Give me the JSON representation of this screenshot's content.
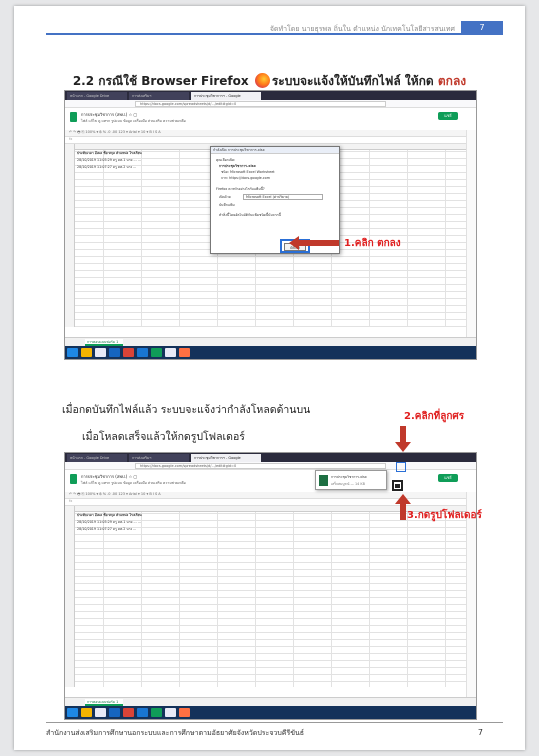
{
  "header": {
    "author_line": "จัดทำโดย นายธุรพล ถิ่นใน ตำแหน่ง นักเทคโนโลยีสารสนเทศ",
    "page_number": "7"
  },
  "section_title": {
    "prefix": "2.2 กรณีใช้ Browser Firefox",
    "suffix": "ระบบจะแจ้งให้บันทึกไฟล์ ให้กด",
    "emphasis": "ตกลง"
  },
  "screenshot1": {
    "tabs": [
      "หน้าแรก - Google Drive",
      "การส่งเสริมฯ",
      "การประชุมวิชาการฯ - Google"
    ],
    "url": "https://docs.google.com/spreadsheets/d/.../edit#gid=0",
    "doc_title": "การประชุมวิชาการ (สพป.) ☆ ▢",
    "doc_menu": "ไฟล์ แก้ไข ดู แทรก รูปแบบ ข้อมูล เครื่องมือ ส่วนเสริม ความช่วยเหลือ",
    "share_label": "แชร์",
    "toolbar": "↶ ↷ 🖶 ⎘ 100% ▾ ฿ % .0 .00 123 ▾ Arial ▾ 10 ▾ B I S A",
    "fx": "fx",
    "rows": [
      "ประทับเวลา        อีเมล           ชื่อ-สกุล         ตำแหน่ง         โรงเรียน",
      "28/10/2019 11:05:29      ครู  คศ.1  นาย ...        ...",
      "28/10/2019 11:07:27      ครู  คศ.2  นาง ..."
    ],
    "sheet_tab": "การตอบแบบฟอร์ม 1",
    "dialog": {
      "title": "กำลังเปิด การประชุมวิชาการ.xlsx",
      "line1": "คุณเลือกเปิด:",
      "file": "การประชุมวิชาการ.xlsx",
      "type": "ชนิด: Microsoft Excel Worksheet",
      "from": "จาก: https://docs.google.com",
      "question": "Firefox ควรทำอย่างไรกับแฟ้มนี้?",
      "open_with": "เปิดด้วย",
      "open_with_value": "Microsoft Excel (ค่าปริยาย)",
      "save_file": "บันทึกแฟ้ม",
      "remember": "ทำสิ่งนี้โดยอัตโนมัติกับแฟ้มชนิดนี้นับจากนี้",
      "ok": "ตกลง"
    },
    "callout": "1.คลิก ตกลง"
  },
  "paragraph": {
    "line1": "เมื่อกดบันทึกไฟล์แล้ว ระบบจะแจ้งว่ากำลังโหลดด้านบน",
    "line2": "เมื่อโหลดเสร็จแล้วให้กดรูปโฟลเดอร์"
  },
  "screenshot2": {
    "tabs": [
      "หน้าแรก - Google Drive",
      "การส่งเสริมฯ",
      "การประชุมวิชาการฯ - Google"
    ],
    "url": "https://docs.google.com/spreadsheets/d/.../edit#gid=0",
    "doc_title": "การประชุมวิชาการ (สพป.) ☆ ▢",
    "doc_menu": "ไฟล์ แก้ไข ดู แทรก รูปแบบ ข้อมูล เครื่องมือ ส่วนเสริม ความช่วยเหลือ",
    "share_label": "แชร์",
    "toolbar": "↶ ↷ 🖶 ⎘ 100% ▾ ฿ % .0 .00 123 ▾ Arial ▾ 10 ▾ B I S A",
    "fx": "fx",
    "rows": [
      "ประทับเวลา        อีเมล           ชื่อ-สกุล         ตำแหน่ง         โรงเรียน",
      "28/10/2019 11:05:29      ครู  คศ.1  นาย ...        ...",
      "28/10/2019 11:07:27      ครู  คศ.2  นาง ..."
    ],
    "sheet_tab": "การตอบแบบฟอร์ม 1",
    "download_popup": {
      "file": "การประชุมวิชาการ.xlsx",
      "status": "เสร็จสมบูรณ์ — 14 KB"
    },
    "callout_arrow": "2.คลิกที่ลูกศร",
    "callout_folder": "3.กดรูปโฟลเดอร์"
  },
  "footer": {
    "org": "สำนักงานส่งเสริมการศึกษานอกระบบและการศึกษาตามอัธยาศัยจังหวัดประจวบคีรีขันธ์",
    "page_number": "7"
  }
}
